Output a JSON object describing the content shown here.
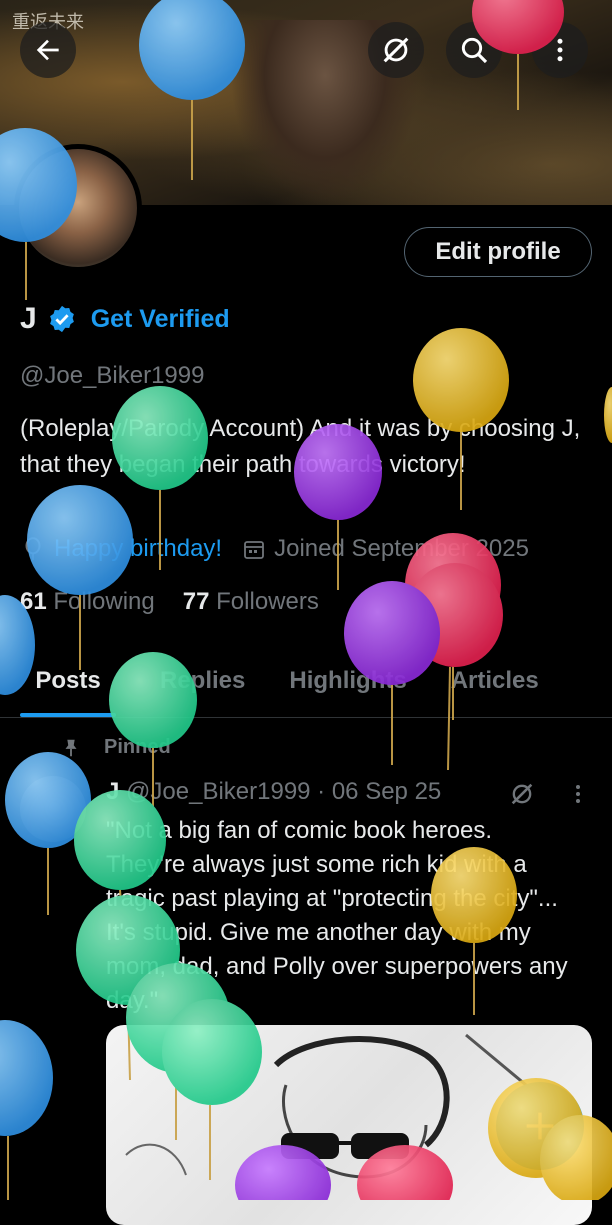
{
  "banner": {
    "watermark": "重返未来"
  },
  "colors": {
    "accent": "#1d9bf0",
    "text": "#e7e9ea",
    "muted": "#71767b",
    "background": "#000000"
  },
  "profile": {
    "edit_label": "Edit profile",
    "name": "J",
    "verified_label": "Get Verified",
    "handle": "@Joe_Biker1999",
    "bio": "(Roleplay/Parody Account) And it was by choosing J, that they began their path towards victory!",
    "birthday": "Happy birthday!",
    "joined": "Joined September 2025",
    "following_count": "61",
    "following_label": "Following",
    "followers_count": "77",
    "followers_label": "Followers"
  },
  "tabs": [
    {
      "label": "Posts"
    },
    {
      "label": "Replies"
    },
    {
      "label": "Highlights"
    },
    {
      "label": "Articles"
    }
  ],
  "post": {
    "pinned_label": "Pinned",
    "author": "J",
    "meta": "@Joe_Biker1999 · 06 Sep 25",
    "text": "\"Not a big fan of comic book heroes. They're always just some rich kid with a tragic past playing at \"protecting the city\"... It's stupid. Give me another day with my mom, dad, and Polly over superpowers any day.\""
  },
  "icons": [
    "back-arrow-icon",
    "grok-icon",
    "search-icon",
    "more-vertical-icon",
    "verified-badge-icon",
    "balloon-icon",
    "calendar-icon",
    "pin-icon",
    "plus-icon"
  ]
}
